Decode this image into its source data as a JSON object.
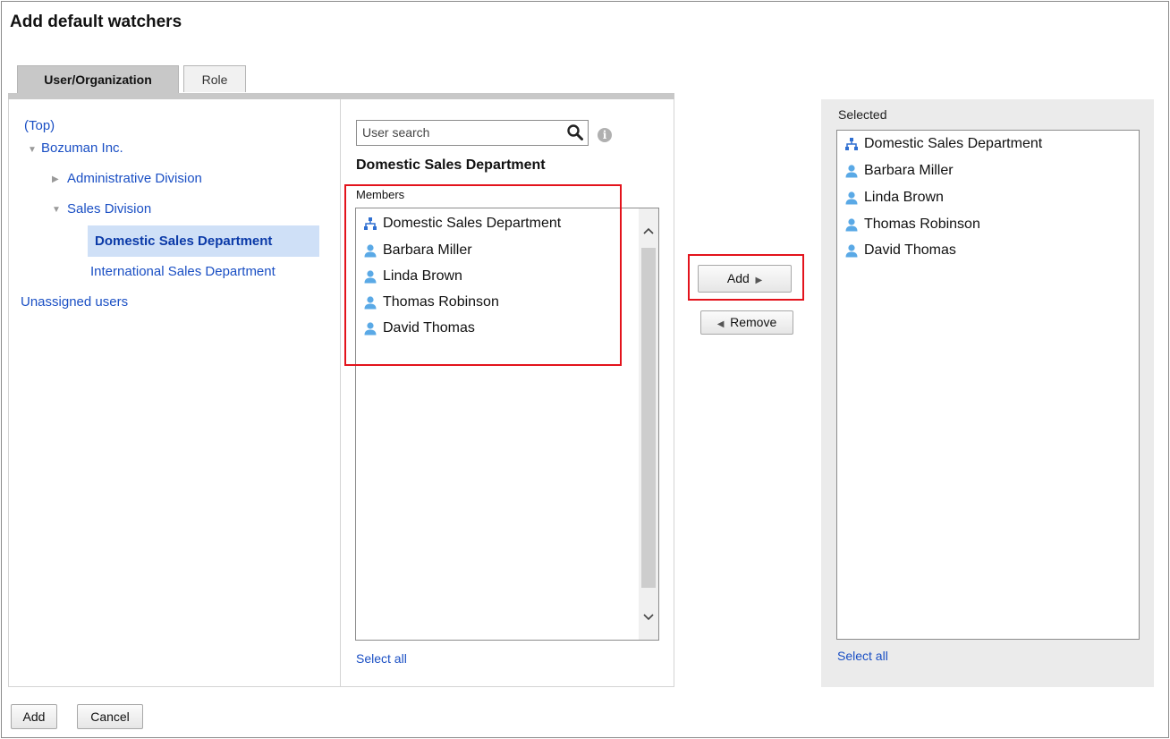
{
  "dialog": {
    "title": "Add default watchers"
  },
  "tabs": [
    {
      "label": "User/Organization",
      "active": true
    },
    {
      "label": "Role",
      "active": false
    }
  ],
  "tree": {
    "top": "(Top)",
    "company": "Bozuman Inc.",
    "admin_division": "Administrative Division",
    "sales_division": "Sales Division",
    "domestic": "Domestic Sales Department",
    "international": "International Sales Department",
    "unassigned": "Unassigned users"
  },
  "search": {
    "placeholder": "User search",
    "value": ""
  },
  "group": {
    "title": "Domestic Sales Department",
    "members_label": "Members"
  },
  "members": [
    {
      "label": "Domestic Sales Department",
      "icon": "organization-icon"
    },
    {
      "label": "Barbara Miller",
      "icon": "user-icon"
    },
    {
      "label": "Linda Brown",
      "icon": "user-icon"
    },
    {
      "label": "Thomas Robinson",
      "icon": "user-icon"
    },
    {
      "label": "David Thomas",
      "icon": "user-icon"
    }
  ],
  "transfer": {
    "add_label": "Add",
    "remove_label": "Remove"
  },
  "selected_panel": {
    "label": "Selected",
    "items": [
      {
        "label": "Domestic Sales Department",
        "icon": "organization-icon"
      },
      {
        "label": "Barbara Miller",
        "icon": "user-icon"
      },
      {
        "label": "Linda Brown",
        "icon": "user-icon"
      },
      {
        "label": "Thomas Robinson",
        "icon": "user-icon"
      },
      {
        "label": "David Thomas",
        "icon": "user-icon"
      }
    ]
  },
  "select_all": "Select all",
  "footer": {
    "add_label": "Add",
    "cancel_label": "Cancel"
  },
  "colors": {
    "link": "#1a4fc4",
    "highlight": "#e3131c",
    "user_icon": "#5aa9e6",
    "org_icon": "#2f6fd1"
  }
}
